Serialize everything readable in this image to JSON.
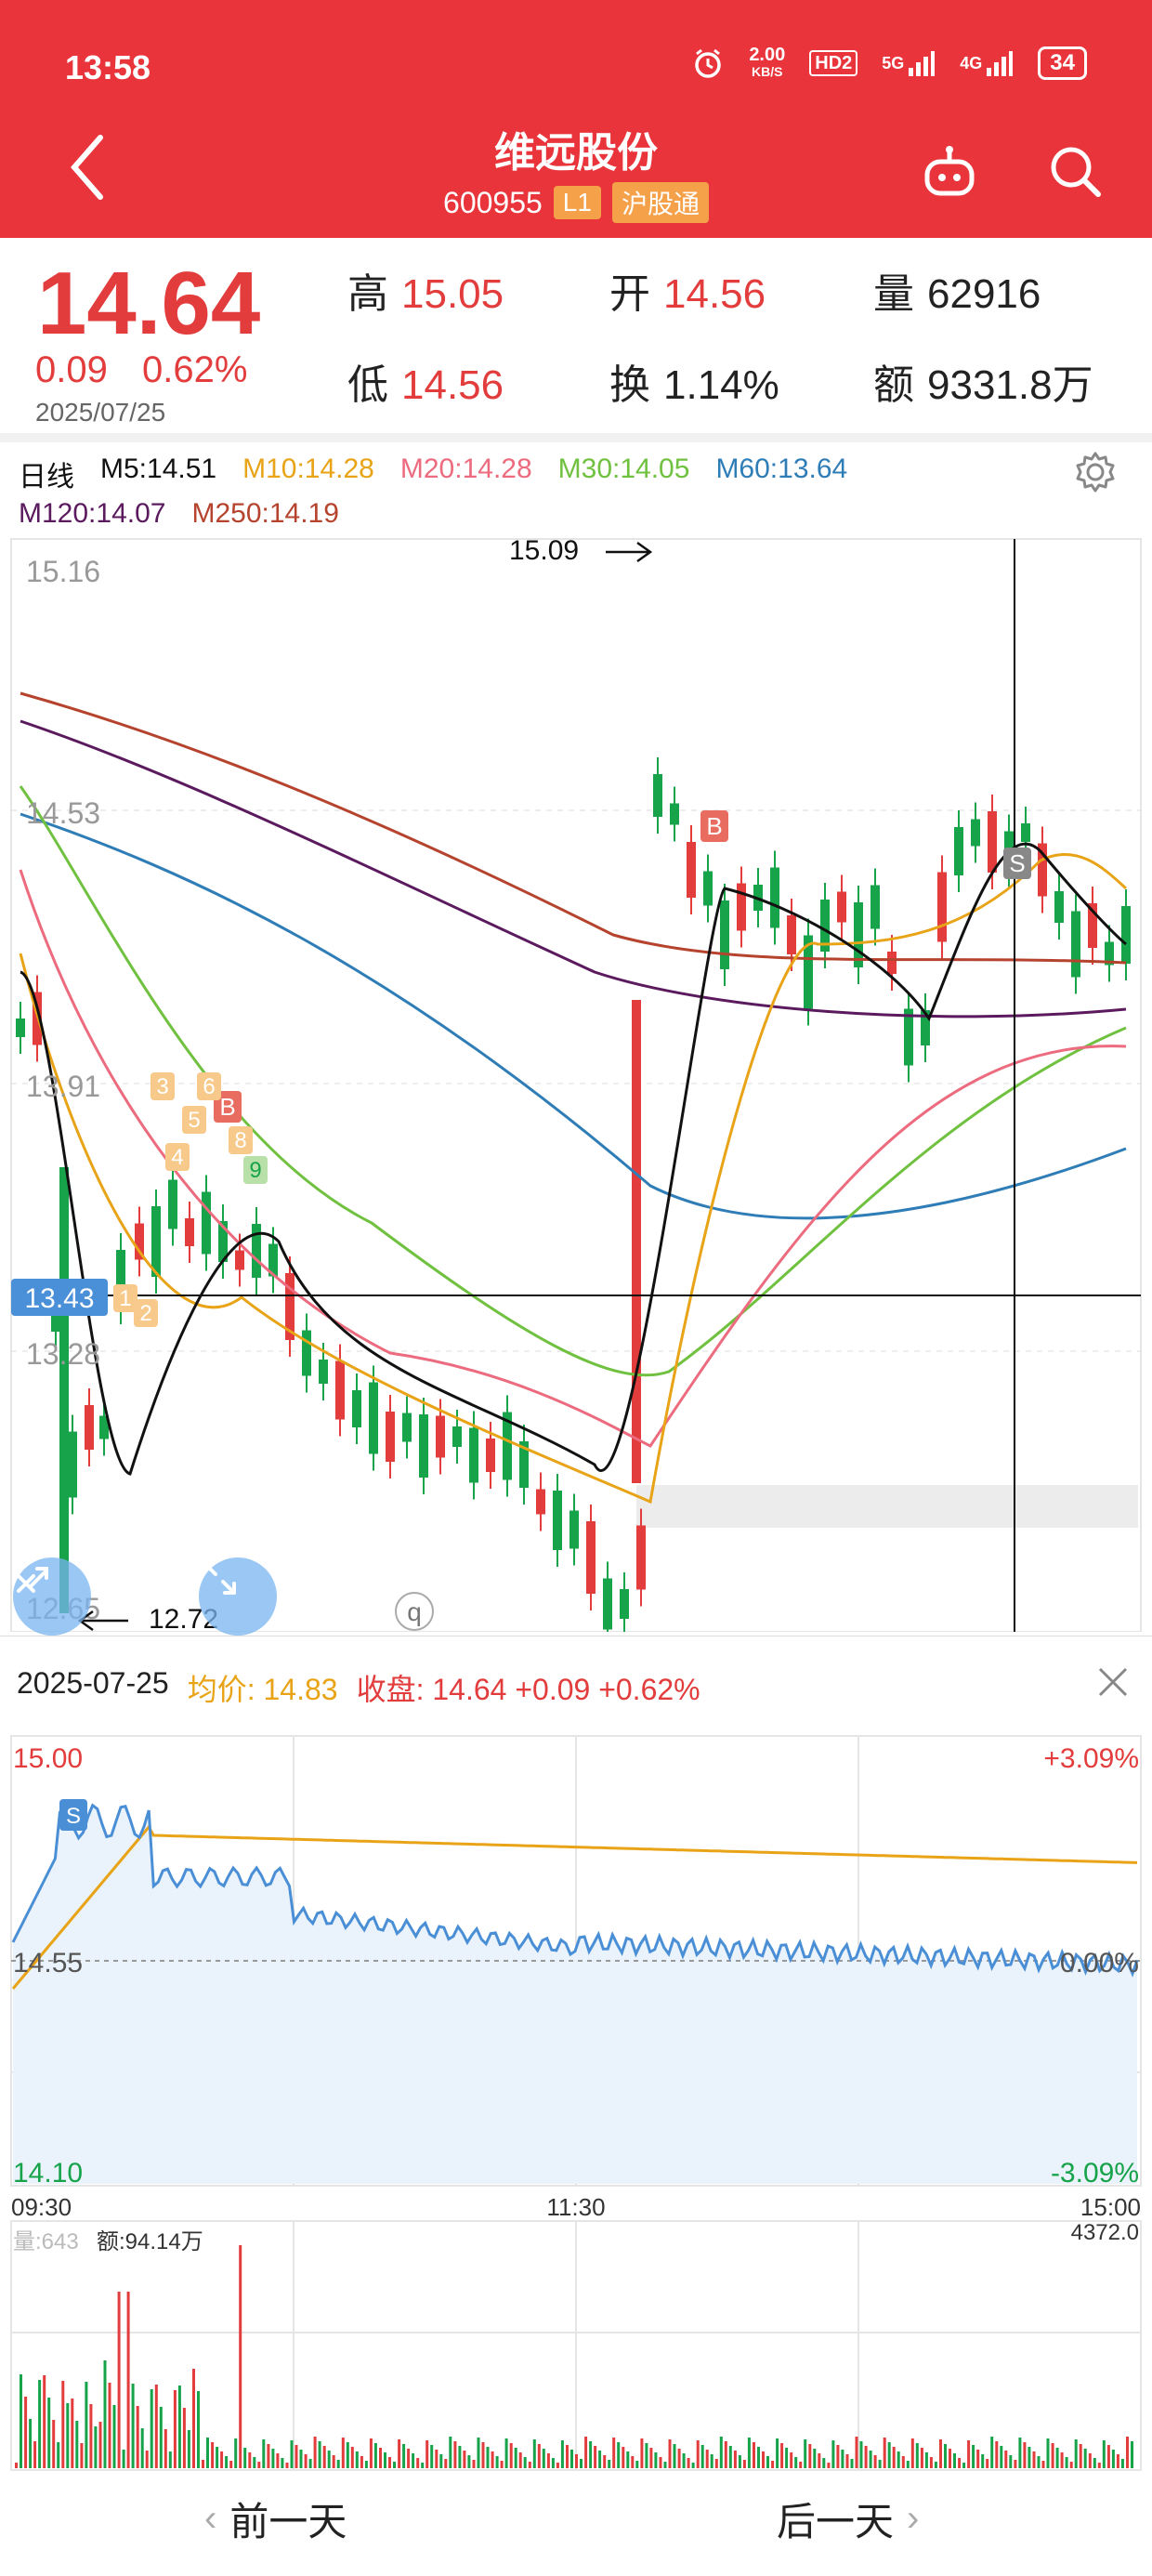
{
  "status": {
    "time": "13:58",
    "net_speed_top": "2.00",
    "net_speed_unit": "KB/S",
    "hd": "HD2",
    "net1": "5G",
    "net2": "4G",
    "battery": "34"
  },
  "nav": {
    "title": "维远股份",
    "code": "600955",
    "level": "L1",
    "connect": "沪股通"
  },
  "quote": {
    "price": "14.64",
    "change": "0.09",
    "change_pct": "0.62%",
    "date": "2025/07/25",
    "high_label": "高",
    "high": "15.05",
    "open_label": "开",
    "open": "14.56",
    "vol_label": "量",
    "vol": "62916",
    "low_label": "低",
    "low": "14.56",
    "turn_label": "换",
    "turn": "1.14%",
    "amt_label": "额",
    "amt": "9331.8万"
  },
  "ma": {
    "period": "日线",
    "m5": "M5:14.51",
    "m10": "M10:14.28",
    "m20": "M20:14.28",
    "m30": "M30:14.05",
    "m60": "M60:13.64",
    "m120": "M120:14.07",
    "m250": "M250:14.19"
  },
  "colors": {
    "m5": "#111111",
    "m10": "#e8a317",
    "m20": "#ec6b7e",
    "m30": "#6fc13f",
    "m60": "#2f7db7",
    "m120": "#5b1a5e",
    "m250": "#b5432e",
    "up": "#e23c3c",
    "down": "#16a34a"
  },
  "kchart": {
    "y_labels": [
      "15.16",
      "14.53",
      "13.91",
      "13.28",
      "12.65"
    ],
    "cursor_price": "13.43",
    "max_label": "15.09",
    "min_label": "12.72",
    "markers": {
      "b1": "B",
      "b2": "B",
      "s": "S"
    },
    "td_nums": [
      "1",
      "2",
      "3",
      "4",
      "5",
      "6",
      "8",
      "9"
    ],
    "q_badge": "q"
  },
  "info": {
    "date": "2025-07-25",
    "avg_label": "均价:",
    "avg": "14.83",
    "close_label": "收盘:",
    "close": "14.64",
    "chg": "+0.09",
    "pct": "+0.62%"
  },
  "minute": {
    "y_top": "15.00",
    "y_mid": "14.55",
    "y_bot": "14.10",
    "pct_top": "+3.09%",
    "pct_mid": "0.00%",
    "pct_bot": "-3.09%",
    "t_start": "09:30",
    "t_mid": "11:30",
    "t_end": "15:00",
    "s_marker": "S",
    "vol_label": "量:643",
    "amt_label": "额:94.14万",
    "vol_max": "4372.0"
  },
  "bottom": {
    "prev": "前一天",
    "next": "后一天"
  }
}
